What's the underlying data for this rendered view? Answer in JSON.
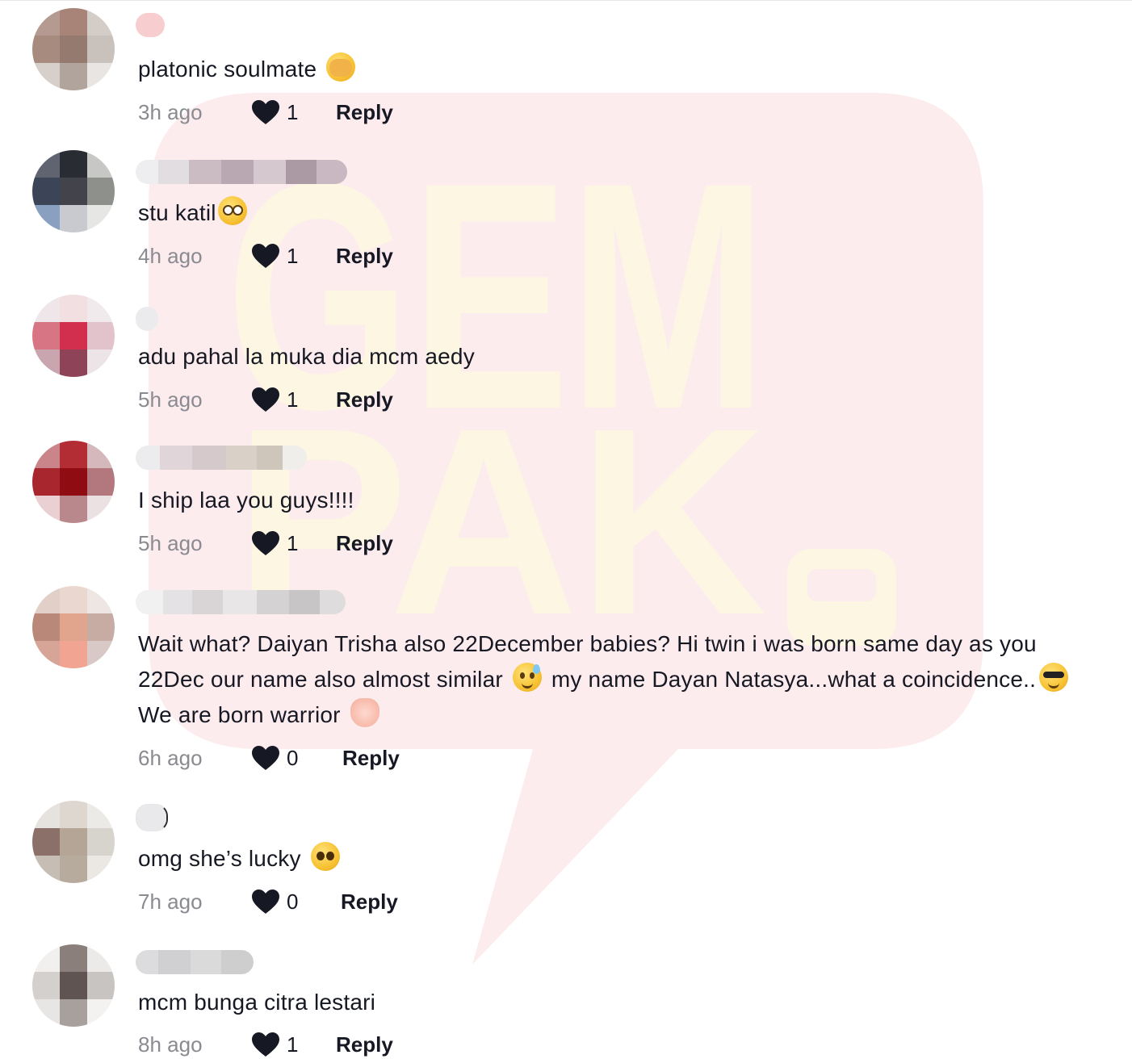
{
  "watermark": {
    "line1": "GEM",
    "line2": "PAK"
  },
  "comments": [
    {
      "text_before": "platonic soulmate",
      "emoji": "see-no-evil-face-emoji",
      "text_after": "",
      "time": "3h ago",
      "likes": "1",
      "reply": "Reply"
    },
    {
      "text_before": "stu katil",
      "emoji": "flushed-face-emoji",
      "text_after": "",
      "time": "4h ago",
      "likes": "1",
      "reply": "Reply"
    },
    {
      "text_before": "adu pahal la muka dia mcm aedy",
      "time": "5h ago",
      "likes": "1",
      "reply": "Reply"
    },
    {
      "text_before": "I ship laa you guys!!!!",
      "time": "5h ago",
      "likes": "1",
      "reply": "Reply"
    },
    {
      "text_part1": "Wait what? Daiyan Trisha also 22December babies? Hi twin i was born same day as you 22Dec our name also almost similar",
      "text_part2": "my name Dayan Natasya...what a coincidence..",
      "text_part3": "We are born warrior",
      "time": "6h ago",
      "likes": "0",
      "reply": "Reply"
    },
    {
      "text_before": "omg she’s lucky",
      "emoji": "pleading-face-emoji",
      "time": "7h ago",
      "likes": "0",
      "reply": "Reply"
    },
    {
      "text_before": "mcm bunga citra lestari",
      "time": "8h ago",
      "likes": "1",
      "reply": "Reply"
    }
  ],
  "colors": {
    "text": "#161823",
    "muted": "#8a8b91",
    "heart": "#161823",
    "watermark_bubble": "#fdecee",
    "watermark_text": "#fdf6e3"
  }
}
